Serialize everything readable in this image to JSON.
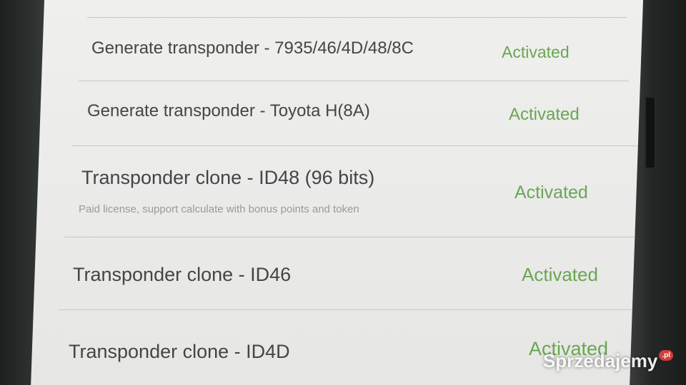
{
  "rows": [
    {
      "title": "Generate transponder - 7935/46/4D/48/8C",
      "status": "Activated"
    },
    {
      "title": "Generate transponder - Toyota H(8A)",
      "status": "Activated"
    },
    {
      "title": "Transponder clone - ID48 (96 bits)",
      "subtitle": "Paid license, support calculate with bonus points and token",
      "status": "Activated"
    },
    {
      "title": "Transponder clone - ID46",
      "status": "Activated"
    },
    {
      "title": "Transponder clone - ID4D",
      "status": "Activated"
    }
  ],
  "watermark": {
    "brand": "Sprzedajemy",
    "tld": ".pl"
  },
  "colors": {
    "status_green": "#6aa653",
    "title_gray": "#454545",
    "background": "#ececea"
  }
}
